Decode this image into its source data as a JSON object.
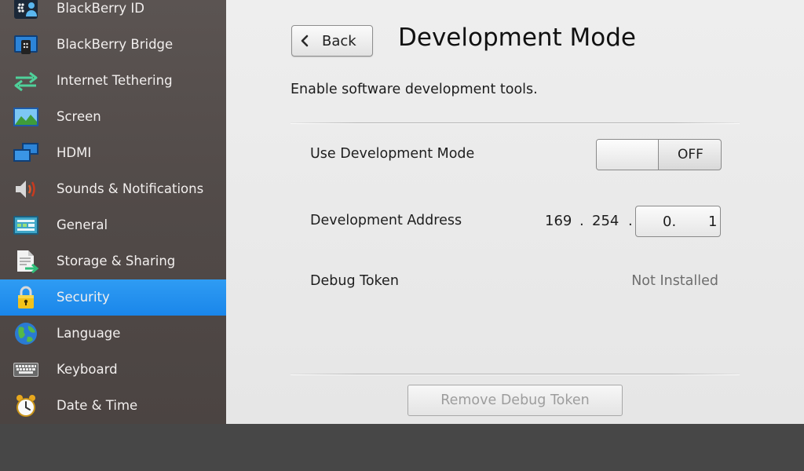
{
  "sidebar": {
    "items": [
      {
        "label": "BlackBerry ID",
        "icon": "blackberry-id-icon"
      },
      {
        "label": "BlackBerry Bridge",
        "icon": "blackberry-bridge-icon"
      },
      {
        "label": "Internet Tethering",
        "icon": "tethering-arrows-icon"
      },
      {
        "label": "Screen",
        "icon": "landscape-picture-icon"
      },
      {
        "label": "HDMI",
        "icon": "dual-monitor-icon"
      },
      {
        "label": "Sounds & Notifications",
        "icon": "speaker-icon"
      },
      {
        "label": "General",
        "icon": "dashboard-icon"
      },
      {
        "label": "Storage & Sharing",
        "icon": "document-share-icon"
      },
      {
        "label": "Security",
        "icon": "padlock-icon",
        "active": true
      },
      {
        "label": "Language",
        "icon": "globe-icon"
      },
      {
        "label": "Keyboard",
        "icon": "keyboard-icon"
      },
      {
        "label": "Date & Time",
        "icon": "alarm-clock-icon"
      }
    ],
    "active_color": "#1f8cef"
  },
  "header": {
    "back_label": "Back",
    "title": "Development Mode"
  },
  "main": {
    "description": "Enable software development tools.",
    "dev_mode": {
      "label": "Use Development Mode",
      "state": "OFF"
    },
    "dev_address": {
      "label": "Development Address",
      "octet1": "169",
      "octet2": "254",
      "octet3": "0.",
      "octet4": "1",
      "separator": "."
    },
    "debug_token": {
      "label": "Debug Token",
      "status": "Not Installed"
    },
    "remove_button_label": "Remove Debug Token"
  }
}
